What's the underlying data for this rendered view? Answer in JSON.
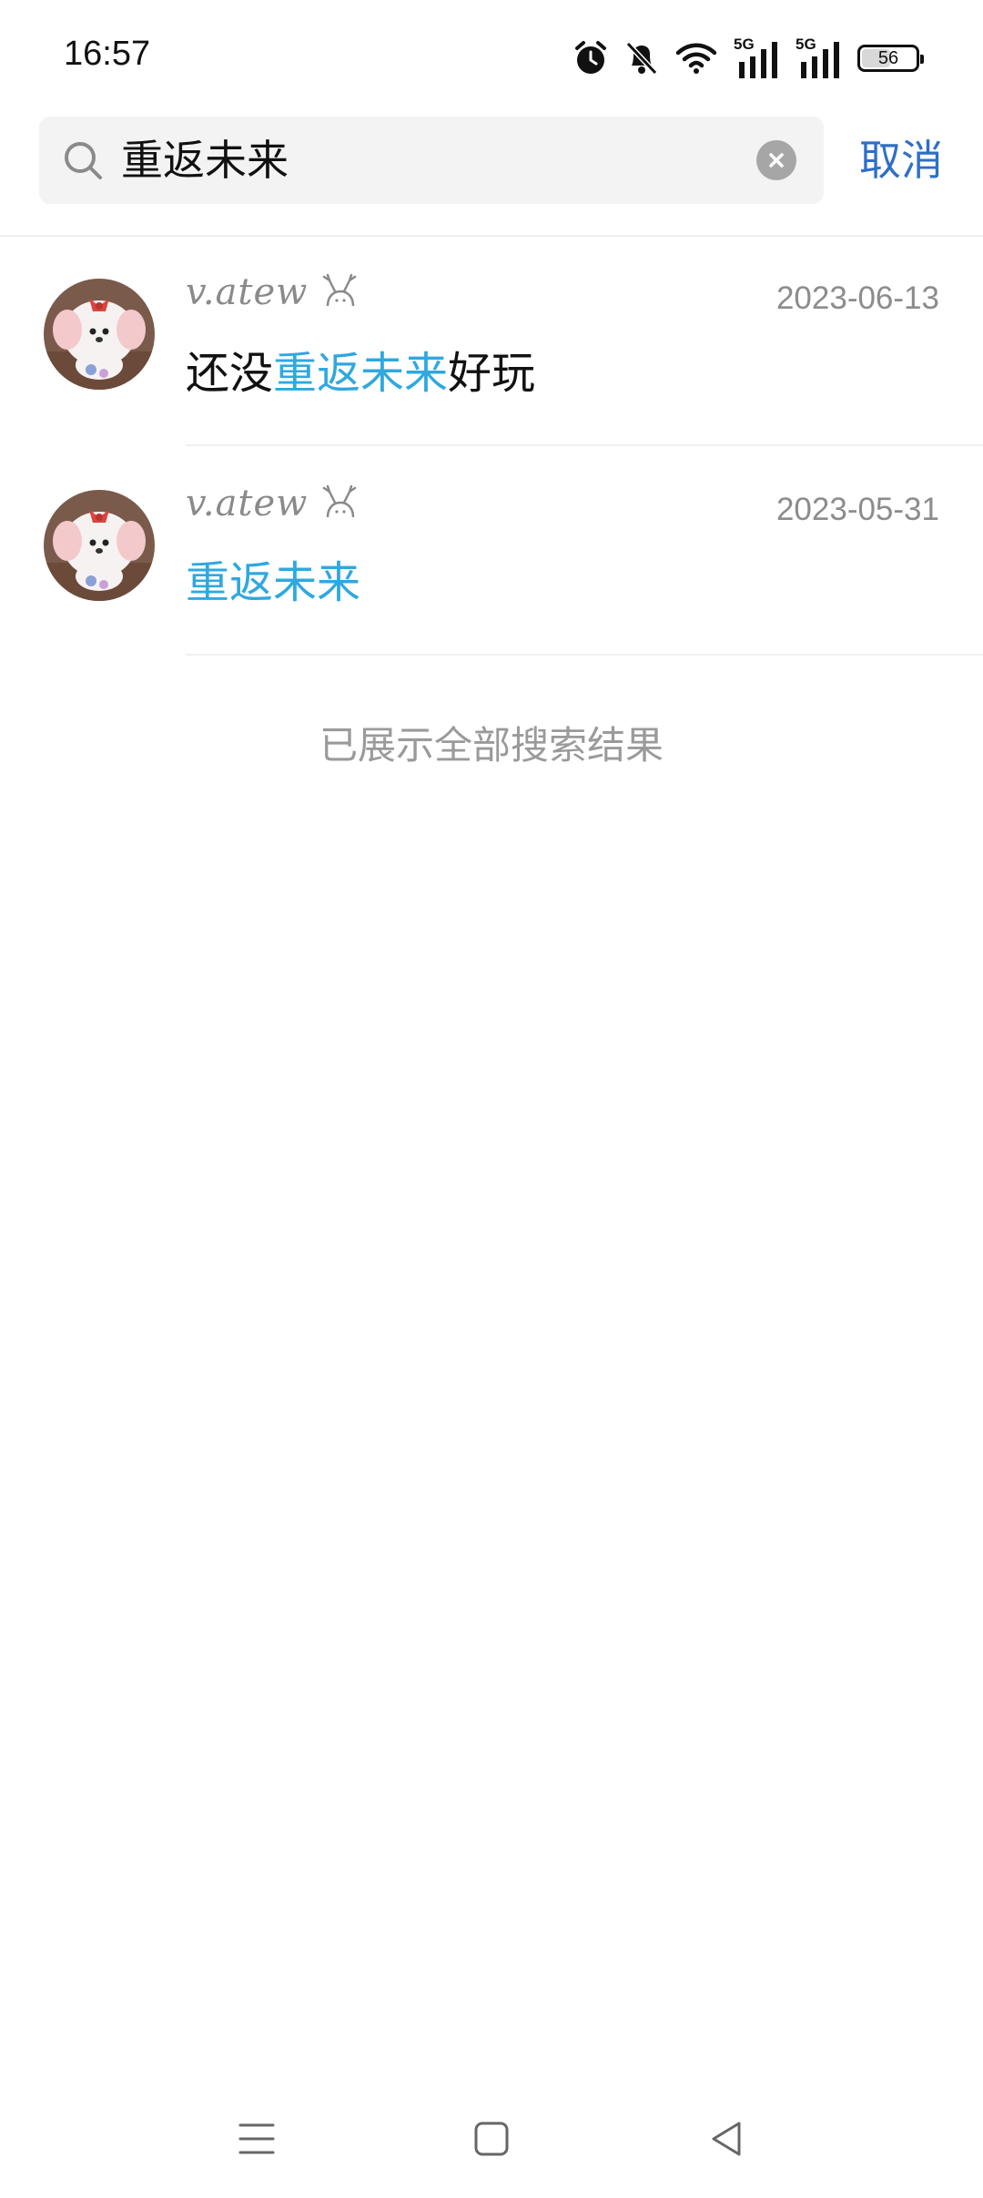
{
  "status_bar": {
    "time": "16:57",
    "icons": [
      "alarm-icon",
      "mute-icon",
      "wifi-icon",
      "signal-5g-icon",
      "signal-5g-icon",
      "battery-icon"
    ],
    "network_label_1": "5G",
    "network_label_2": "5G",
    "battery_level": 56,
    "battery_text": "56"
  },
  "search": {
    "query": "重返未来",
    "cancel_label": "取消"
  },
  "results": [
    {
      "username": "v.atew",
      "date": "2023-06-13",
      "snippet_before": "还没",
      "snippet_highlight": "重返未来",
      "snippet_after": "好玩"
    },
    {
      "username": "v.atew",
      "date": "2023-05-31",
      "snippet_before": "",
      "snippet_highlight": "重返未来",
      "snippet_after": ""
    }
  ],
  "footer_note": "已展示全部搜索结果",
  "colors": {
    "highlight": "#2fa8df",
    "cancel": "#2f6fc7",
    "secondary_text": "#8c8c8c"
  },
  "nav": {
    "icons": [
      "menu-icon",
      "home-icon",
      "back-icon"
    ]
  }
}
